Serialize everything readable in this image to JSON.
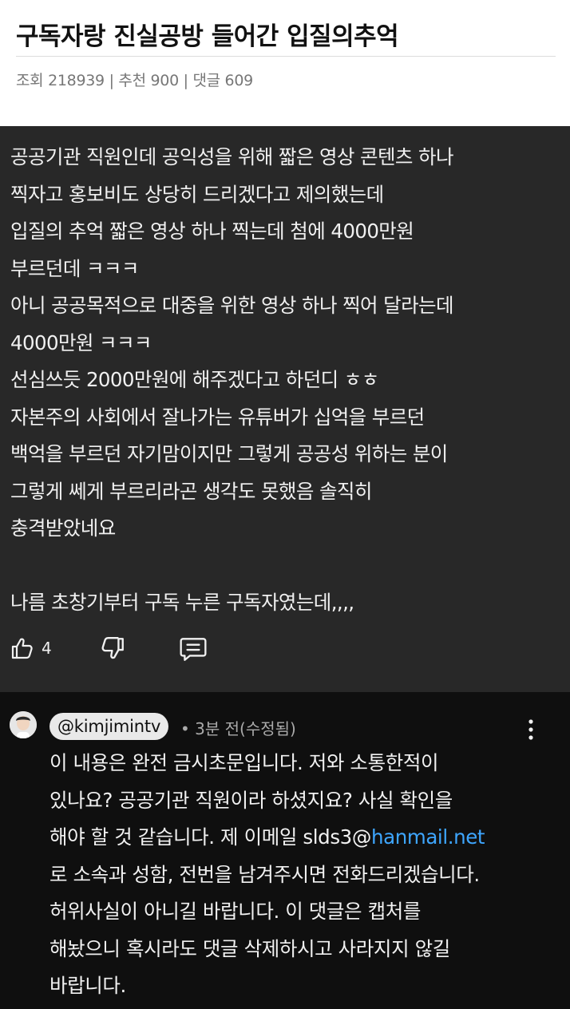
{
  "header": {
    "title": "구독자랑 진실공방 들어간 입질의추억",
    "meta": "조회 218939 | 추천 900 | 댓글 609"
  },
  "post": {
    "lines": [
      "공공기관 직원인데 공익성을 위해 짧은 영상 콘텐츠 하나",
      "찍자고 홍보비도 상당히 드리겠다고 제의했는데",
      "입질의 추억 짧은 영상 하나 찍는데 첨에 4000만원",
      "부르던데 ㅋㅋㅋ",
      "아니 공공목적으로 대중을 위한 영상 하나 찍어 달라는데",
      "4000만원 ㅋㅋㅋ",
      "선심쓰듯 2000만원에 해주겠다고 하던디 ㅎㅎ",
      "자본주의 사회에서 잘나가는 유튜버가 십억을 부르던",
      "백억을 부르던 자기맘이지만 그렇게 공공성 위하는 분이",
      "그렇게 쎄게 부르리라곤 생각도 못했음 솔직히",
      "충격받았네요",
      "",
      "나름 초창기부터 구독 누른 구독자였는데,,,,"
    ],
    "like_count": "4",
    "icons": {
      "like": "thumbs-up-icon",
      "dislike": "thumbs-down-icon",
      "reply": "comment-icon"
    }
  },
  "reply": {
    "handle": "@kimjimintv",
    "time": "• 3분 전(수정됨)",
    "line1": "이 내용은 완전 금시초문입니다. 저와 소통한적이",
    "line2": "있나요? 공공기관 직원이라 하셨지요? 사실 확인을",
    "line3_pre": "해야 할 것 같습니다. 제 이메일 slds3@",
    "line3_link": "hanmail.net",
    "line4": "로 소속과 성함, 전번을 남겨주시면 전화드리겠습니다.",
    "line5": "허위사실이 아니길 바랍니다. 이 댓글은 캡처를",
    "line6": "해놨으니 혹시라도 댓글 삭제하시고 사라지지 않길",
    "line7": "바랍니다.",
    "icons": {
      "avatar": "avatar",
      "more": "more-vert-icon"
    }
  },
  "colors": {
    "post_bg": "#282828",
    "reply_bg": "#0f0f0f",
    "link": "#3ea6ff",
    "text": "#f1f1f1",
    "muted": "#aaaaaa"
  }
}
